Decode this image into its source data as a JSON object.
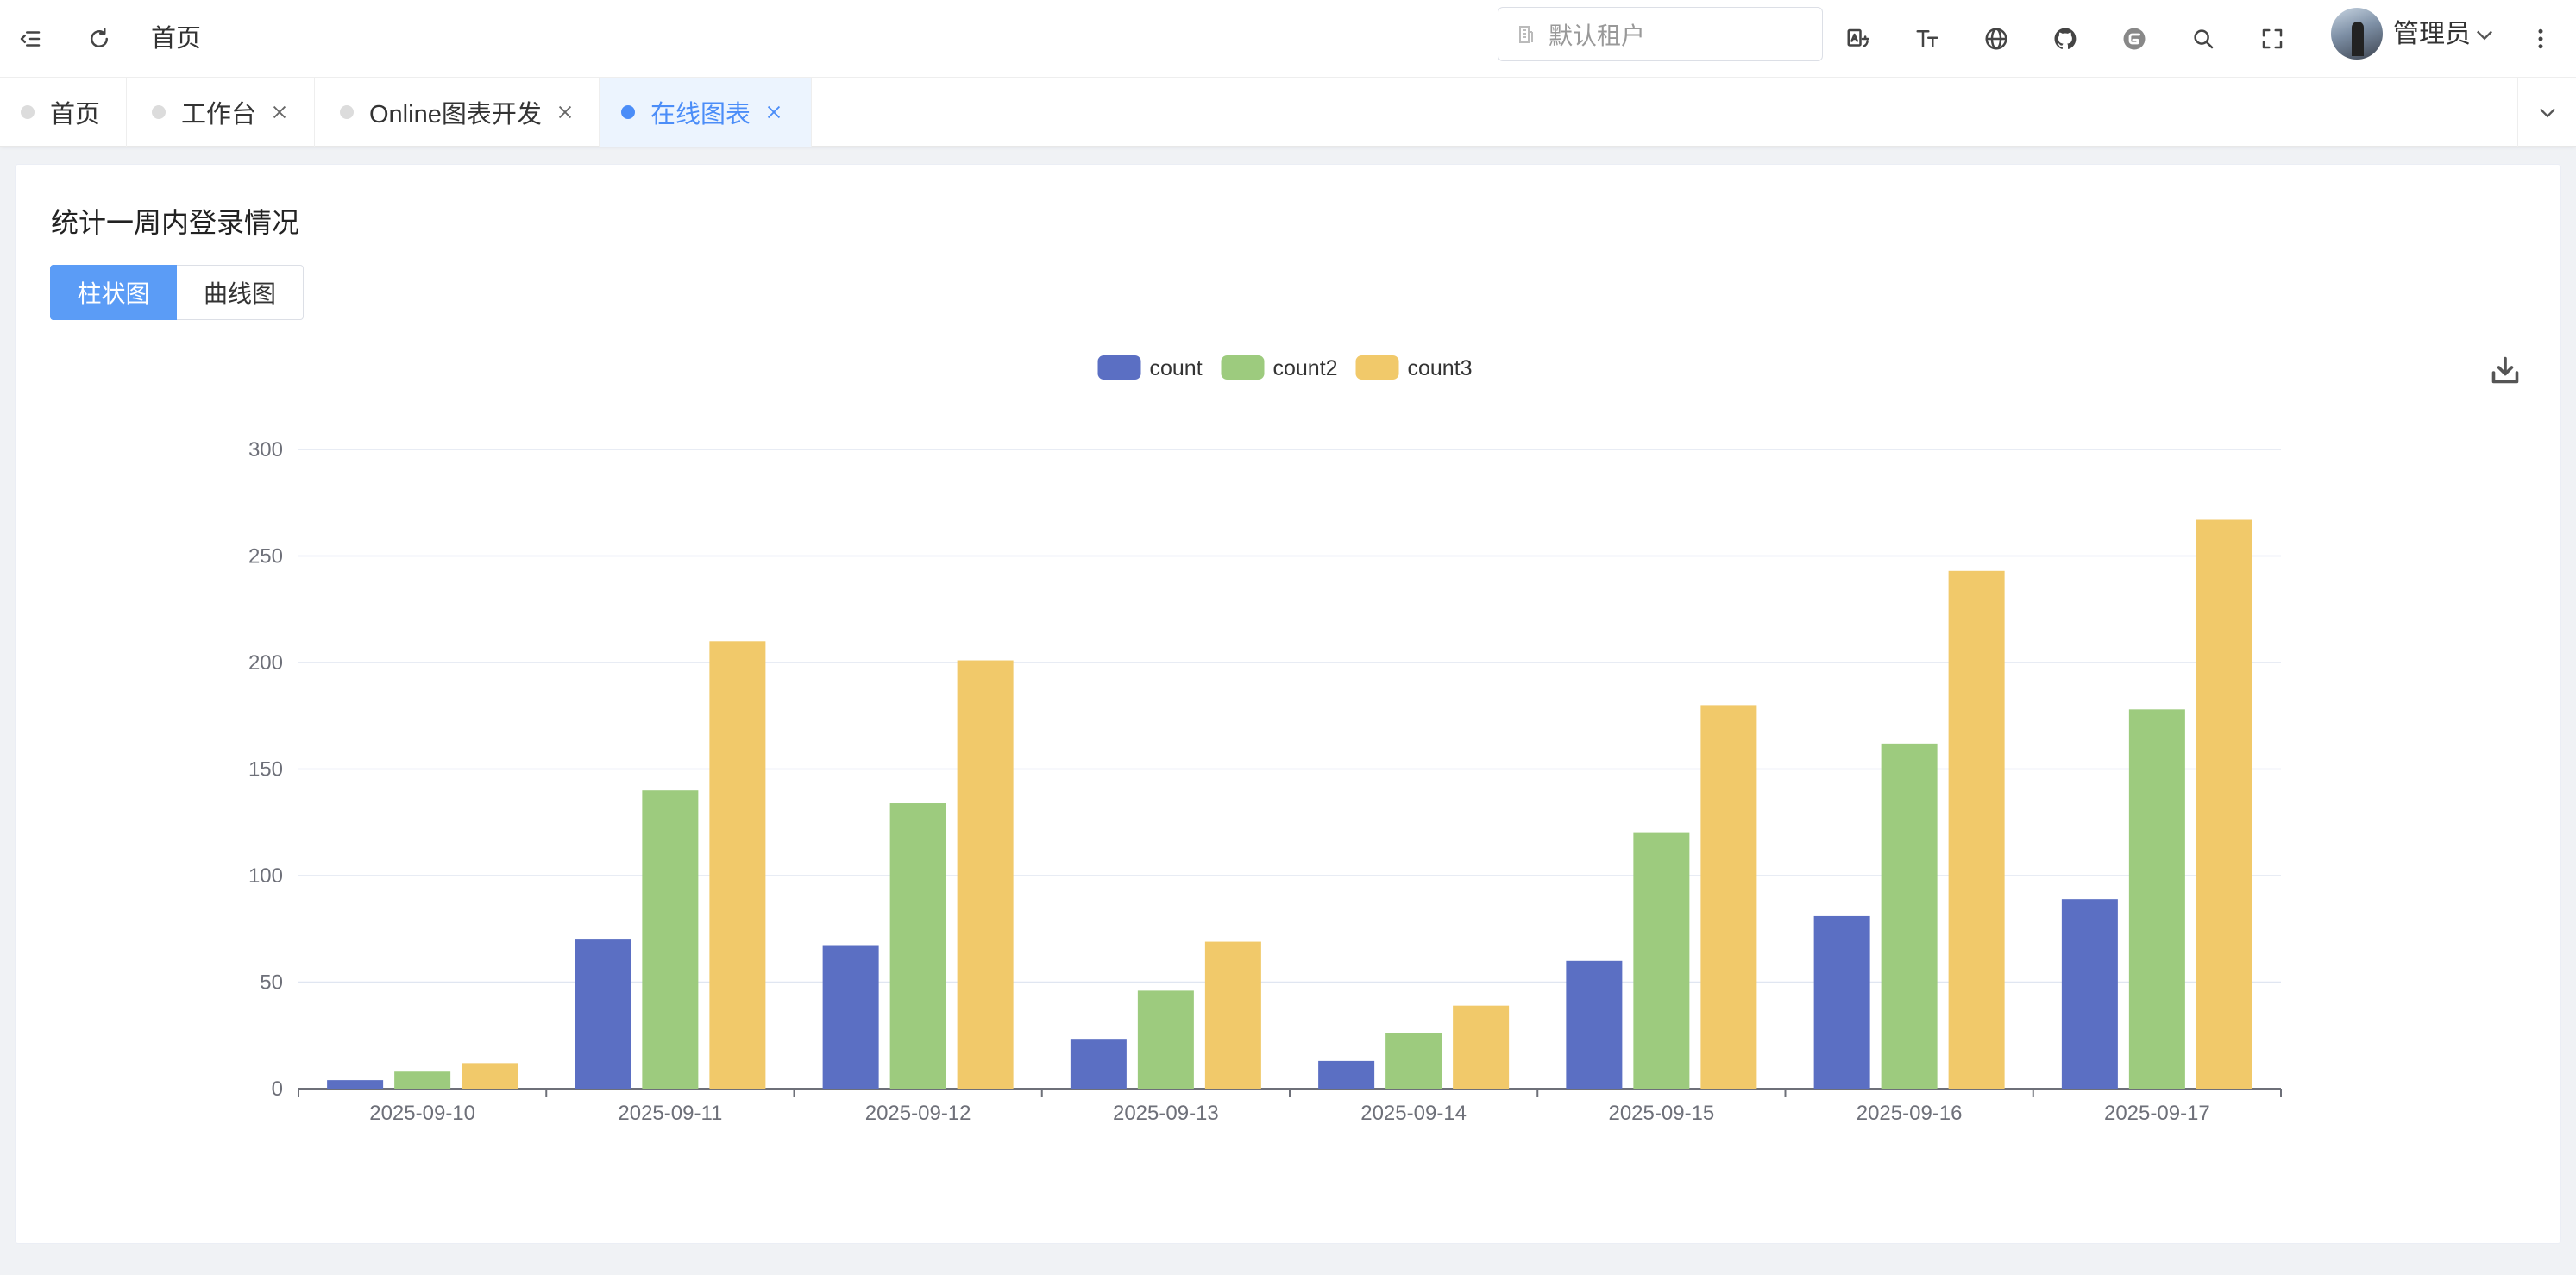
{
  "header": {
    "breadcrumb": "首页",
    "tenant_placeholder": "默认租户",
    "username": "管理员"
  },
  "tabs": [
    {
      "label": "首页",
      "closable": false,
      "active": false
    },
    {
      "label": "工作台",
      "closable": true,
      "active": false
    },
    {
      "label": "Online图表开发",
      "closable": true,
      "active": false
    },
    {
      "label": "在线图表",
      "closable": true,
      "active": true
    }
  ],
  "card": {
    "title": "统计一周内登录情况",
    "buttons": [
      "柱状图",
      "曲线图"
    ],
    "active_button": "柱状图"
  },
  "colors": {
    "accent": "#4b8df8",
    "count": "#5b6fc3",
    "count2": "#9dcb7e",
    "count3": "#f1c96a"
  },
  "chart_data": {
    "type": "bar",
    "categories": [
      "2025-09-10",
      "2025-09-11",
      "2025-09-12",
      "2025-09-13",
      "2025-09-14",
      "2025-09-15",
      "2025-09-16",
      "2025-09-17"
    ],
    "series": [
      {
        "name": "count",
        "color": "#5b6fc3",
        "values": [
          4,
          70,
          67,
          23,
          13,
          60,
          81,
          89
        ]
      },
      {
        "name": "count2",
        "color": "#9dcb7e",
        "values": [
          8,
          140,
          134,
          46,
          26,
          120,
          162,
          178
        ]
      },
      {
        "name": "count3",
        "color": "#f1c96a",
        "values": [
          12,
          210,
          201,
          69,
          39,
          180,
          243,
          267
        ]
      }
    ],
    "yticks": [
      0,
      50,
      100,
      150,
      200,
      250,
      300
    ],
    "ylim": [
      0,
      300
    ],
    "grid": true,
    "legend": "top-center"
  }
}
